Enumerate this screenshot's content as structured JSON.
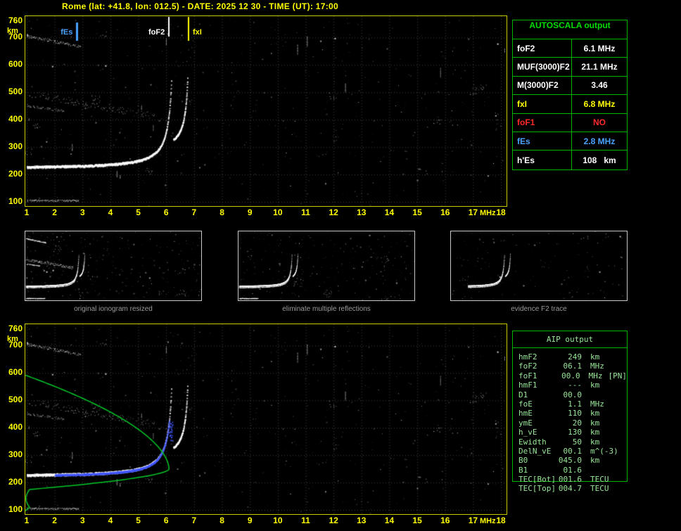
{
  "title": "Rome (lat: +41.8, lon: 012.5) - DATE: 2025 12 30 - TIME (UT): 17:00",
  "top_plot": {
    "type": "ionogram",
    "y_unit": "km",
    "x_unit": "MHz",
    "y_ticks": [
      "760",
      "700",
      "600",
      "500",
      "400",
      "300",
      "200",
      "100"
    ],
    "x_ticks": [
      "1",
      "2",
      "3",
      "4",
      "5",
      "6",
      "7",
      "8",
      "9",
      "10",
      "11",
      "12",
      "13",
      "14",
      "15",
      "16",
      "17",
      "18"
    ],
    "markers": [
      {
        "label": "fEs",
        "freq_mhz": 2.8,
        "color": "#4aa3ff",
        "side": "left"
      },
      {
        "label": "foF2",
        "freq_mhz": 6.1,
        "color": "#ffffff",
        "side": "left"
      },
      {
        "label": "fxI",
        "freq_mhz": 6.8,
        "color": "#ffff00",
        "side": "right"
      }
    ]
  },
  "bottom_plot": {
    "type": "ionogram-with-profile",
    "y_unit": "km",
    "x_unit": "MHz",
    "y_ticks": [
      "760",
      "700",
      "600",
      "500",
      "400",
      "300",
      "200",
      "100"
    ],
    "x_ticks": [
      "1",
      "2",
      "3",
      "4",
      "5",
      "6",
      "7",
      "8",
      "9",
      "10",
      "11",
      "12",
      "13",
      "14",
      "15",
      "16",
      "17",
      "18"
    ]
  },
  "autoscala_table": {
    "title": "AUTOSCALA output",
    "rows": [
      {
        "param": "foF2",
        "value": "6.1 MHz",
        "color": "#ffffff"
      },
      {
        "param": "MUF(3000)F2",
        "value": "21.1 MHz",
        "color": "#ffffff"
      },
      {
        "param": "M(3000)F2",
        "value": "3.46",
        "color": "#ffffff"
      },
      {
        "param": "fxI",
        "value": "6.8 MHz",
        "color": "#ffff00"
      },
      {
        "param": "foF1",
        "value": "NO",
        "color": "#ff2a2a"
      },
      {
        "param": "fEs",
        "value": "2.8 MHz",
        "color": "#4aa3ff"
      },
      {
        "param": "h'Es",
        "value": "108   km",
        "color": "#ffffff"
      }
    ]
  },
  "thumbnails": [
    {
      "caption": "original ionogram resized"
    },
    {
      "caption": "eliminate multiple reflections"
    },
    {
      "caption": "evidence F2 trace"
    }
  ],
  "aip_table": {
    "title": "AIP output",
    "rows": [
      {
        "param": "hmF2",
        "value": "249",
        "unit": "km",
        "extra": ""
      },
      {
        "param": "foF2",
        "value": "06.1",
        "unit": "MHz",
        "extra": ""
      },
      {
        "param": "foF1",
        "value": "00.0",
        "unit": "MHz",
        "extra": "[PN]"
      },
      {
        "param": "hmF1",
        "value": "---",
        "unit": "km",
        "extra": ""
      },
      {
        "param": "D1",
        "value": "00.0",
        "unit": "",
        "extra": ""
      },
      {
        "param": "foE",
        "value": "1.1",
        "unit": "MHz",
        "extra": ""
      },
      {
        "param": "hmE",
        "value": "110",
        "unit": "km",
        "extra": ""
      },
      {
        "param": "ymE",
        "value": "20",
        "unit": "km",
        "extra": ""
      },
      {
        "param": "h_vE",
        "value": "130",
        "unit": "km",
        "extra": ""
      },
      {
        "param": "Ewidth",
        "value": "50",
        "unit": "km",
        "extra": ""
      },
      {
        "param": "DelN_vE",
        "value": "00.1",
        "unit": "m^(-3)",
        "extra": ""
      },
      {
        "param": "B0",
        "value": "045.0",
        "unit": "km",
        "extra": ""
      },
      {
        "param": "B1",
        "value": "01.6",
        "unit": "",
        "extra": ""
      }
    ],
    "tec_rows": [
      {
        "param": "TEC[Bot]",
        "value": "001.6",
        "unit": "TECU"
      },
      {
        "param": "TEC[Top]",
        "value": "004.7",
        "unit": "TECU"
      }
    ]
  },
  "colors": {
    "title_yellow": "#ffff00",
    "plot_border": "#c8c800",
    "table_green": "#00b400",
    "table_text_green": "#00dd00",
    "aip_text": "#98e698",
    "caption_gray": "#9a9a9a",
    "profile_green": "#00c828",
    "trace_blue": "#4257ff"
  }
}
